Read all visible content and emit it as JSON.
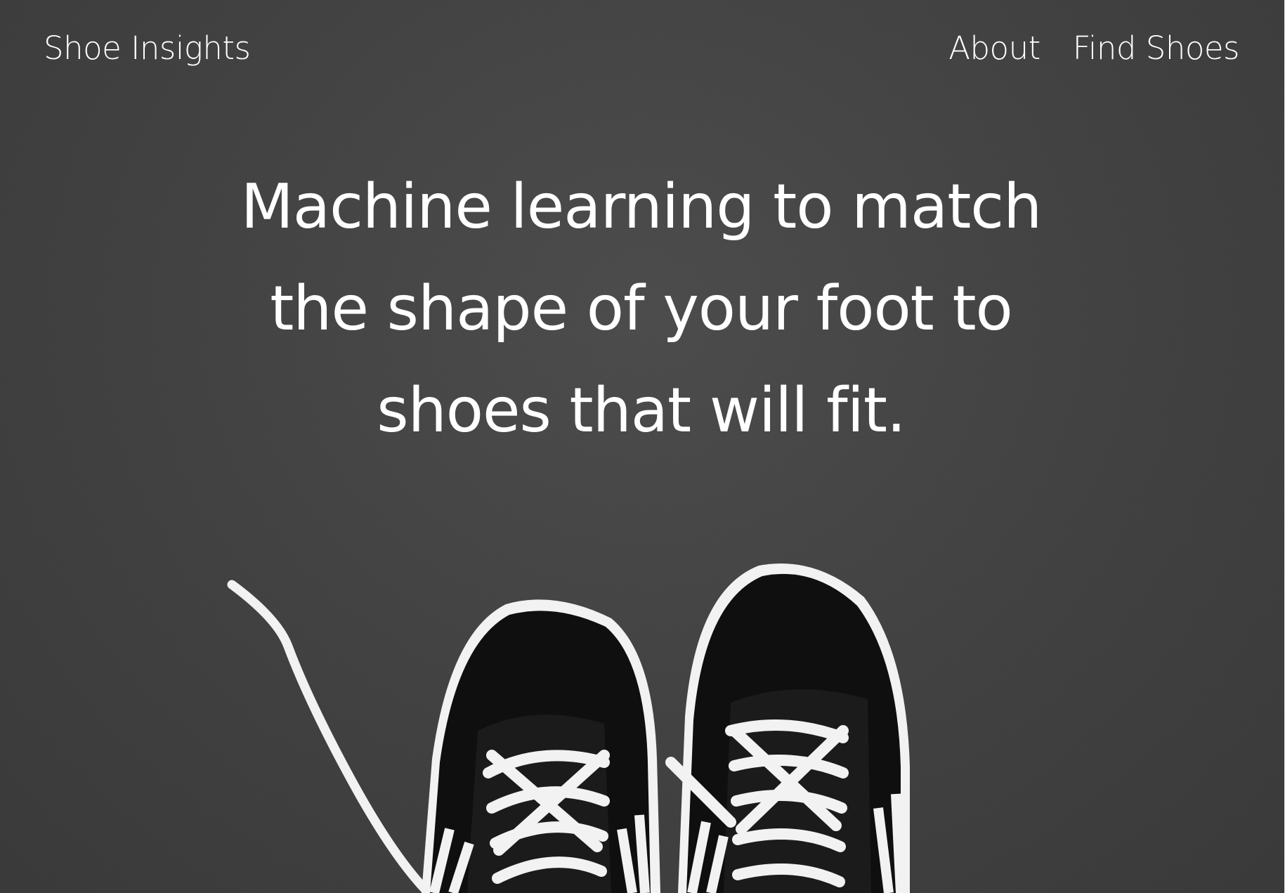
{
  "header": {
    "brand": "Shoe Insights",
    "nav": [
      {
        "label": "About"
      },
      {
        "label": "Find Shoes"
      }
    ]
  },
  "hero": {
    "headline_lines": [
      "Machine learning to match",
      "the shape of your foot to",
      "shoes that will fit."
    ]
  },
  "image": {
    "subject": "black-and-white-sneakers-icon",
    "background": "gray-asphalt"
  },
  "colors": {
    "background": "#3f3f3f",
    "text": "#ffffff",
    "shoe": "#0e0e0e",
    "lace": "#f2f2f2"
  }
}
